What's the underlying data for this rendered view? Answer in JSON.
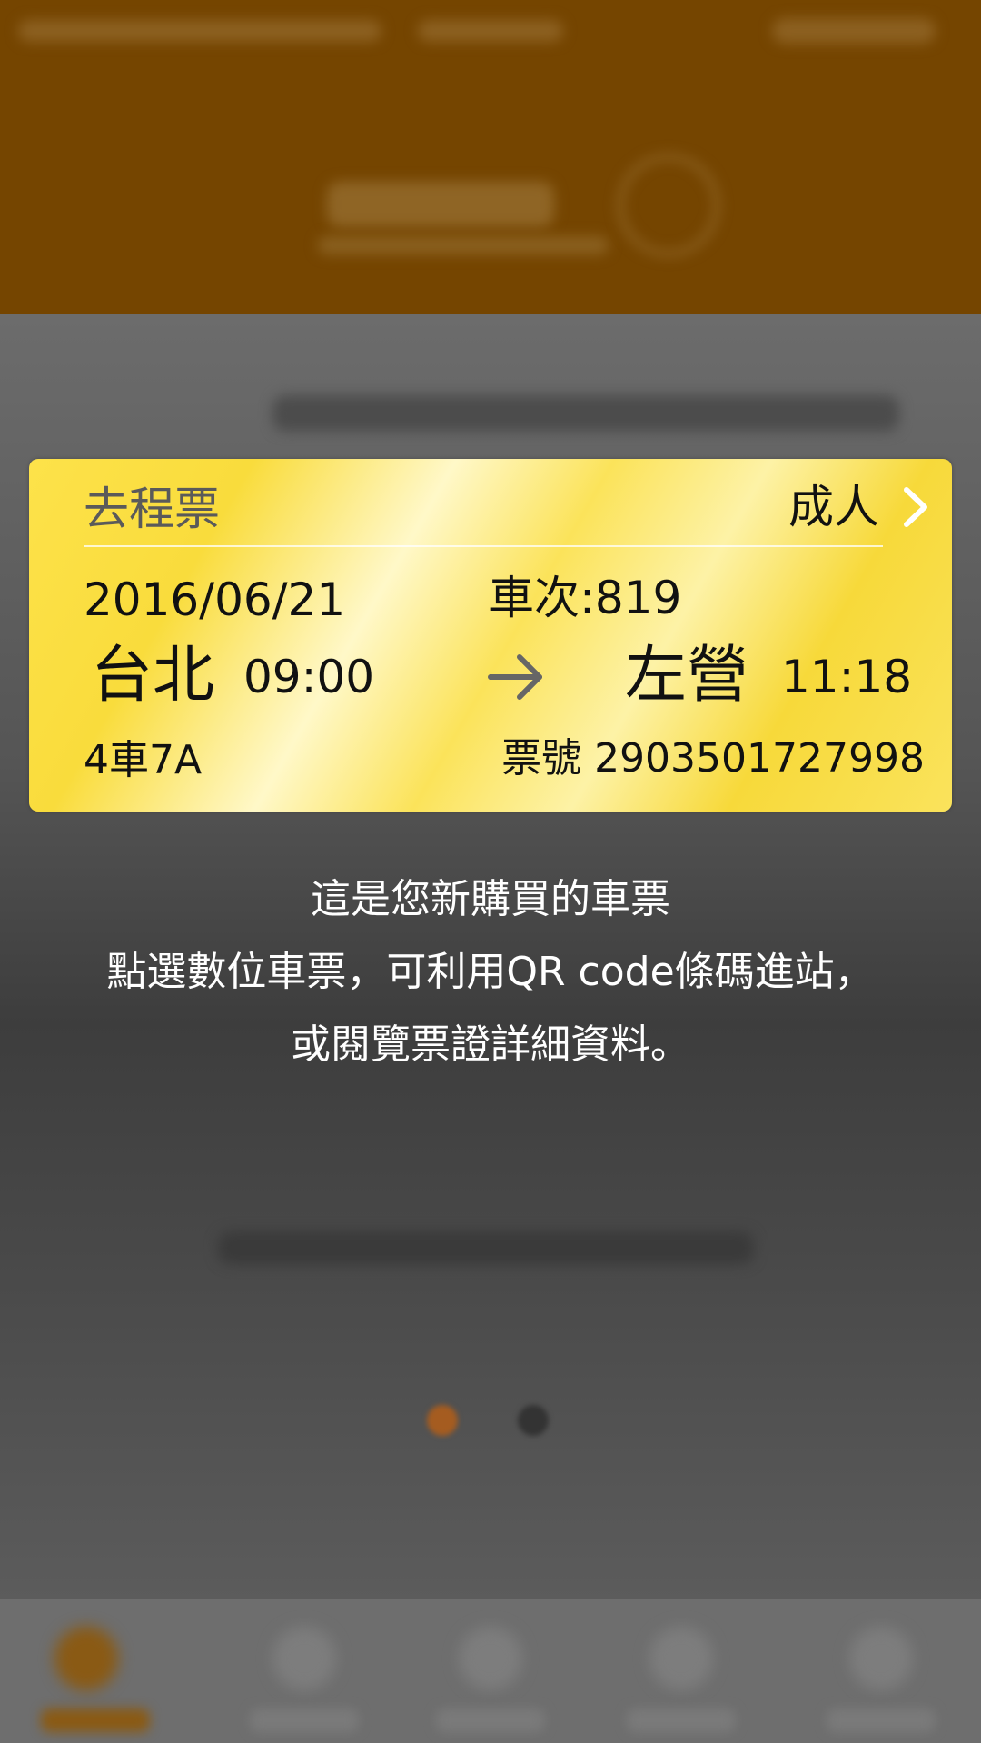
{
  "ticket": {
    "type_label": "去程票",
    "passenger": "成人",
    "date": "2016/06/21",
    "train_no": "車次:819",
    "origin": "台北",
    "depart_time": "09:00",
    "destination": "左營",
    "arrive_time": "11:18",
    "seat": "4車7A",
    "ticket_no": "票號 2903501727998"
  },
  "message": {
    "line1": "這是您新購買的車票",
    "line2": "點選數位車票，可利用QR code條碼進站，",
    "line3": "或閱覽票證詳細資料。"
  },
  "colors": {
    "header_bg": "#754500",
    "ticket_yellow": "#fde24a",
    "accent_orange": "#8a5a14"
  },
  "icons": {
    "chevron": "chevron-right-icon",
    "arrow": "arrow-right-icon"
  }
}
